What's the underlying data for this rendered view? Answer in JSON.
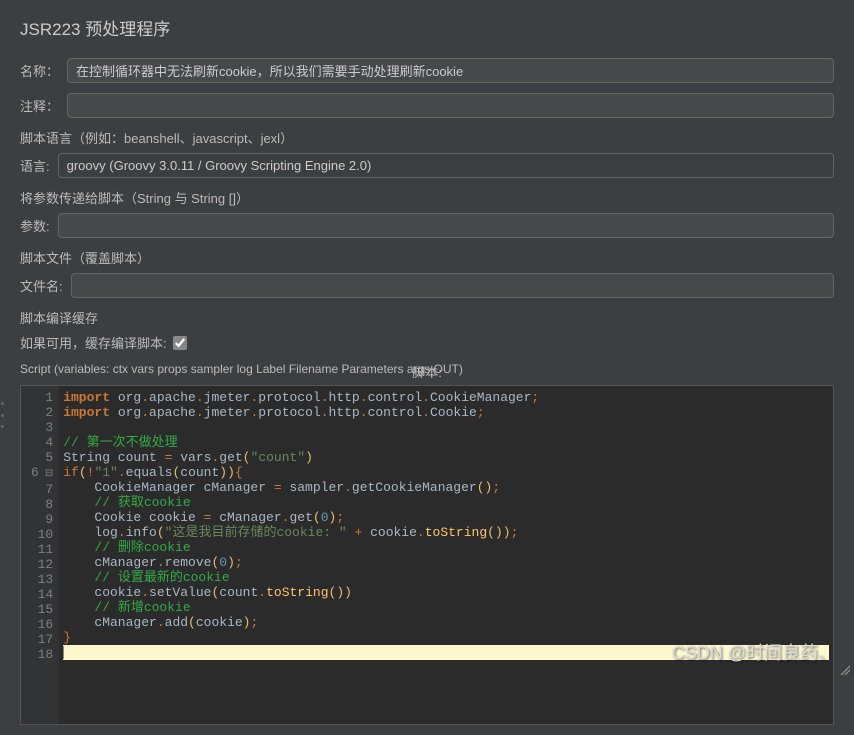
{
  "title": "JSR223 预处理程序",
  "labels": {
    "name": "名称：",
    "comment": "注释：",
    "scriptLangSection": "脚本语言（例如：beanshell、javascript、jexl）",
    "lang": "语言:",
    "passParamsSection": "将参数传递给脚本（String 与 String []）",
    "params": "参数:",
    "scriptFileSection": "脚本文件（覆盖脚本）",
    "filename": "文件名:",
    "cacheSection": "脚本编译缓存",
    "cacheCheckbox": "如果可用，缓存编译脚本:",
    "scriptInfo": "Script (variables: ctx vars props sampler log Label Filename Parameters args OUT)",
    "scriptRight": "脚本:"
  },
  "values": {
    "name": "在控制循环器中无法刷新cookie，所以我们需要手动处理刷新cookie",
    "comment": "",
    "lang": "groovy     (Groovy 3.0.11 / Groovy Scripting Engine 2.0)",
    "params": "",
    "filename": "",
    "cacheChecked": true
  },
  "code": {
    "lines": [
      {
        "n": 1,
        "tokens": [
          [
            "kw",
            "import"
          ],
          [
            "plain",
            " org"
          ],
          [
            "punct",
            "."
          ],
          [
            "plain",
            "apache"
          ],
          [
            "punct",
            "."
          ],
          [
            "plain",
            "jmeter"
          ],
          [
            "punct",
            "."
          ],
          [
            "plain",
            "protocol"
          ],
          [
            "punct",
            "."
          ],
          [
            "plain",
            "http"
          ],
          [
            "punct",
            "."
          ],
          [
            "plain",
            "control"
          ],
          [
            "punct",
            "."
          ],
          [
            "plain",
            "CookieManager"
          ],
          [
            "punct",
            ";"
          ]
        ]
      },
      {
        "n": 2,
        "tokens": [
          [
            "kw",
            "import"
          ],
          [
            "plain",
            " org"
          ],
          [
            "punct",
            "."
          ],
          [
            "plain",
            "apache"
          ],
          [
            "punct",
            "."
          ],
          [
            "plain",
            "jmeter"
          ],
          [
            "punct",
            "."
          ],
          [
            "plain",
            "protocol"
          ],
          [
            "punct",
            "."
          ],
          [
            "plain",
            "http"
          ],
          [
            "punct",
            "."
          ],
          [
            "plain",
            "control"
          ],
          [
            "punct",
            "."
          ],
          [
            "plain",
            "Cookie"
          ],
          [
            "punct",
            ";"
          ]
        ]
      },
      {
        "n": 3,
        "tokens": []
      },
      {
        "n": 4,
        "tokens": [
          [
            "comment-cn",
            "// 第一次不做处理"
          ]
        ]
      },
      {
        "n": 5,
        "tokens": [
          [
            "plain",
            "String count "
          ],
          [
            "punct",
            "="
          ],
          [
            "plain",
            " vars"
          ],
          [
            "punct",
            "."
          ],
          [
            "plain",
            "get"
          ],
          [
            "bracket",
            "("
          ],
          [
            "str",
            "\"count\""
          ],
          [
            "bracket",
            ")"
          ]
        ]
      },
      {
        "n": 6,
        "fold": true,
        "tokens": [
          [
            "kw2",
            "if"
          ],
          [
            "bracket",
            "("
          ],
          [
            "punct",
            "!"
          ],
          [
            "str",
            "\"1\""
          ],
          [
            "punct",
            "."
          ],
          [
            "plain",
            "equals"
          ],
          [
            "bracket",
            "("
          ],
          [
            "plain",
            "count"
          ],
          [
            "bracket",
            "))"
          ],
          [
            "brace",
            "{"
          ]
        ]
      },
      {
        "n": 7,
        "tokens": [
          [
            "plain",
            "    CookieManager cManager "
          ],
          [
            "punct",
            "="
          ],
          [
            "plain",
            " sampler"
          ],
          [
            "punct",
            "."
          ],
          [
            "plain",
            "getCookieManager"
          ],
          [
            "bracket",
            "()"
          ],
          [
            "punct",
            ";"
          ]
        ]
      },
      {
        "n": 8,
        "tokens": [
          [
            "plain",
            "    "
          ],
          [
            "comment-cn",
            "// 获取cookie"
          ]
        ]
      },
      {
        "n": 9,
        "tokens": [
          [
            "plain",
            "    Cookie cookie "
          ],
          [
            "punct",
            "="
          ],
          [
            "plain",
            " cManager"
          ],
          [
            "punct",
            "."
          ],
          [
            "plain",
            "get"
          ],
          [
            "bracket",
            "("
          ],
          [
            "num",
            "0"
          ],
          [
            "bracket",
            ")"
          ],
          [
            "punct",
            ";"
          ]
        ]
      },
      {
        "n": 10,
        "tokens": [
          [
            "plain",
            "    log"
          ],
          [
            "punct",
            "."
          ],
          [
            "plain",
            "info"
          ],
          [
            "bracket",
            "("
          ],
          [
            "str",
            "\"这是我目前存储的cookie: \""
          ],
          [
            "plain",
            " "
          ],
          [
            "punct",
            "+"
          ],
          [
            "plain",
            " cookie"
          ],
          [
            "punct",
            "."
          ],
          [
            "method",
            "toString"
          ],
          [
            "bracket",
            "()"
          ],
          [
            "bracket",
            ")"
          ],
          [
            "punct",
            ";"
          ]
        ]
      },
      {
        "n": 11,
        "tokens": [
          [
            "plain",
            "    "
          ],
          [
            "comment-cn",
            "// 删除cookie"
          ]
        ]
      },
      {
        "n": 12,
        "tokens": [
          [
            "plain",
            "    cManager"
          ],
          [
            "punct",
            "."
          ],
          [
            "plain",
            "remove"
          ],
          [
            "bracket",
            "("
          ],
          [
            "num",
            "0"
          ],
          [
            "bracket",
            ")"
          ],
          [
            "punct",
            ";"
          ]
        ]
      },
      {
        "n": 13,
        "tokens": [
          [
            "plain",
            "    "
          ],
          [
            "comment-cn",
            "// 设置最新的cookie"
          ]
        ]
      },
      {
        "n": 14,
        "tokens": [
          [
            "plain",
            "    cookie"
          ],
          [
            "punct",
            "."
          ],
          [
            "plain",
            "setValue"
          ],
          [
            "bracket",
            "("
          ],
          [
            "plain",
            "count"
          ],
          [
            "punct",
            "."
          ],
          [
            "method",
            "toString"
          ],
          [
            "bracket",
            "()"
          ],
          [
            "bracket",
            ")"
          ]
        ]
      },
      {
        "n": 15,
        "tokens": [
          [
            "plain",
            "    "
          ],
          [
            "comment-cn",
            "// 新增cookie"
          ]
        ]
      },
      {
        "n": 16,
        "tokens": [
          [
            "plain",
            "    cManager"
          ],
          [
            "punct",
            "."
          ],
          [
            "plain",
            "add"
          ],
          [
            "bracket",
            "("
          ],
          [
            "plain",
            "cookie"
          ],
          [
            "bracket",
            ")"
          ],
          [
            "punct",
            ";"
          ]
        ]
      },
      {
        "n": 17,
        "tokens": [
          [
            "brace",
            "}"
          ]
        ]
      },
      {
        "n": 18,
        "current": true,
        "tokens": []
      }
    ]
  },
  "watermark": "CSDN @时间良药、"
}
